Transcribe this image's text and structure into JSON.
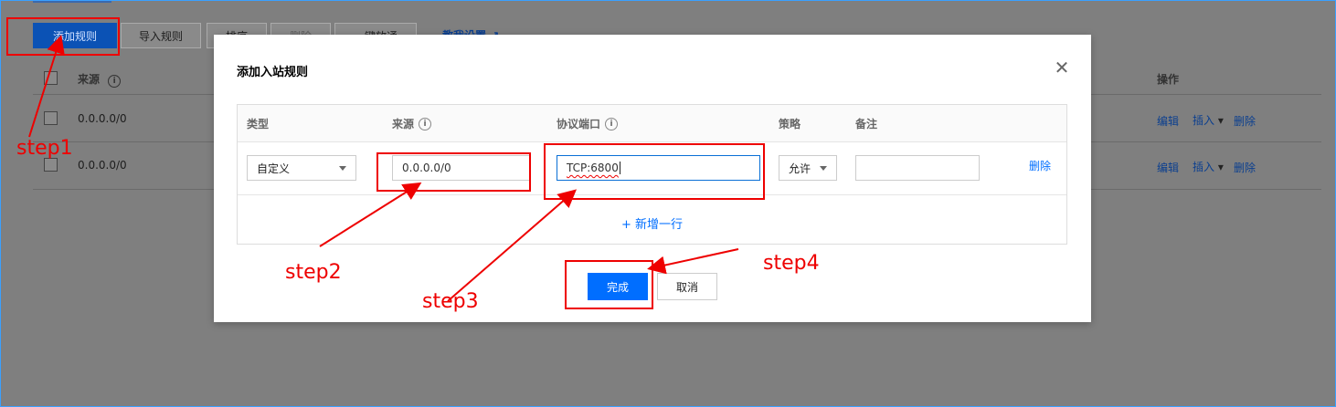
{
  "background": {
    "toolbar": {
      "add_rule": "添加规则",
      "import_rule": "导入规则",
      "sort": "排序",
      "delete": "删除",
      "one_click": "一键放通",
      "tutorial": "教我设置"
    },
    "columns": {
      "source": "来源",
      "actions": "操作"
    },
    "rows": [
      {
        "source": "0.0.0.0/0",
        "edit": "编辑",
        "insert": "插入",
        "delete": "删除"
      },
      {
        "source": "0.0.0.0/0",
        "edit": "编辑",
        "insert": "插入",
        "delete": "删除"
      }
    ]
  },
  "modal": {
    "title": "添加入站规则",
    "columns": {
      "type": "类型",
      "source": "来源",
      "port": "协议端口",
      "policy": "策略",
      "note": "备注"
    },
    "row": {
      "type": "自定义",
      "source": "0.0.0.0/0",
      "port": "TCP:6800",
      "policy": "允许",
      "note": "",
      "delete": "删除"
    },
    "add_row": "+ 新增一行",
    "confirm": "完成",
    "cancel": "取消"
  },
  "annotations": {
    "step1": "step1",
    "step2": "step2",
    "step3": "step3",
    "step4": "step4",
    "color": "#e00000"
  }
}
